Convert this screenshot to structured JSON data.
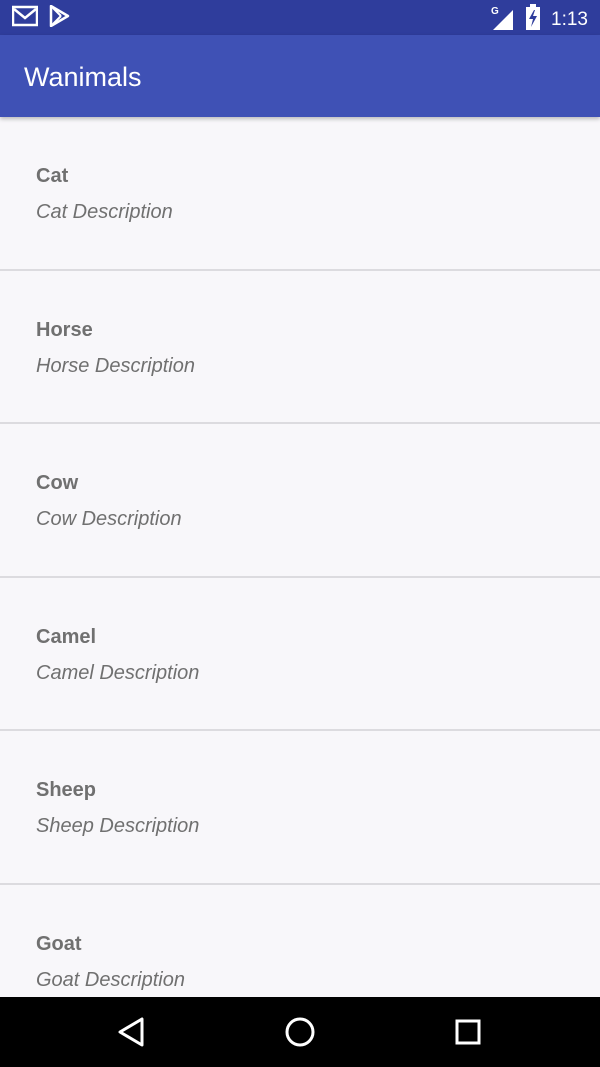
{
  "status_bar": {
    "time": "1:13",
    "network": "G",
    "icons": [
      "gmail-icon",
      "play-store-icon",
      "signal-icon",
      "battery-charging-icon"
    ]
  },
  "app_bar": {
    "title": "Wanimals"
  },
  "animals": [
    {
      "name": "Cat",
      "description": "Cat Description"
    },
    {
      "name": "Horse",
      "description": "Horse Description"
    },
    {
      "name": "Cow",
      "description": "Cow Description"
    },
    {
      "name": "Camel",
      "description": "Camel Description"
    },
    {
      "name": "Sheep",
      "description": "Sheep Description"
    },
    {
      "name": "Goat",
      "description": "Goat Description"
    }
  ],
  "nav_bar": {
    "icons": [
      "back-icon",
      "home-icon",
      "recents-icon"
    ]
  },
  "colors": {
    "status_bar": "#2f3d9c",
    "app_bar": "#3f51b5",
    "background": "#f8f7fa",
    "text": "#707070",
    "divider": "#dcdbdf"
  }
}
